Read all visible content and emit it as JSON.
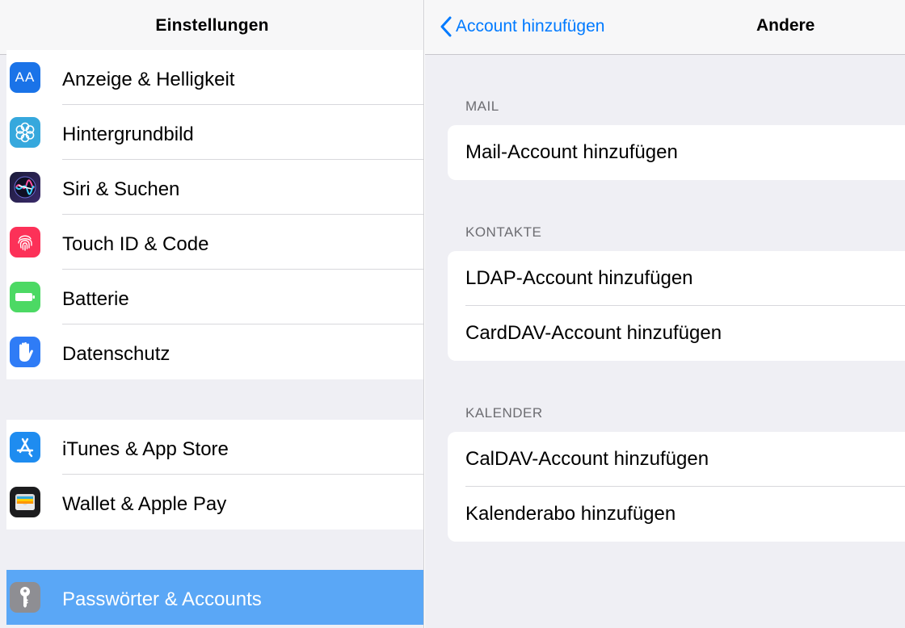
{
  "sidebar": {
    "title": "Einstellungen",
    "group1": [
      {
        "label": "Anzeige & Helligkeit",
        "icon": "display-brightness-icon"
      },
      {
        "label": "Hintergrundbild",
        "icon": "wallpaper-icon"
      },
      {
        "label": "Siri & Suchen",
        "icon": "siri-icon"
      },
      {
        "label": "Touch ID & Code",
        "icon": "touch-id-icon"
      },
      {
        "label": "Batterie",
        "icon": "battery-icon"
      },
      {
        "label": "Datenschutz",
        "icon": "privacy-hand-icon"
      }
    ],
    "group2": [
      {
        "label": "iTunes & App Store",
        "icon": "app-store-icon"
      },
      {
        "label": "Wallet & Apple Pay",
        "icon": "wallet-icon"
      }
    ],
    "group3": [
      {
        "label": "Passwörter & Accounts",
        "icon": "key-icon",
        "selected": true
      }
    ],
    "icon_text": {
      "display": "AA"
    }
  },
  "detail": {
    "back_label": "Account hinzufügen",
    "title": "Andere",
    "sections": [
      {
        "header": "MAIL",
        "items": [
          "Mail-Account hinzufügen"
        ]
      },
      {
        "header": "KONTAKTE",
        "items": [
          "LDAP-Account hinzufügen",
          "CardDAV-Account hinzufügen"
        ]
      },
      {
        "header": "KALENDER",
        "items": [
          "CalDAV-Account hinzufügen",
          "Kalenderabo hinzufügen"
        ]
      }
    ]
  },
  "colors": {
    "accent": "#007aff",
    "selected_row": "#5aa7f6",
    "grouped_background": "#efeff4",
    "section_header": "#6d6d72"
  }
}
